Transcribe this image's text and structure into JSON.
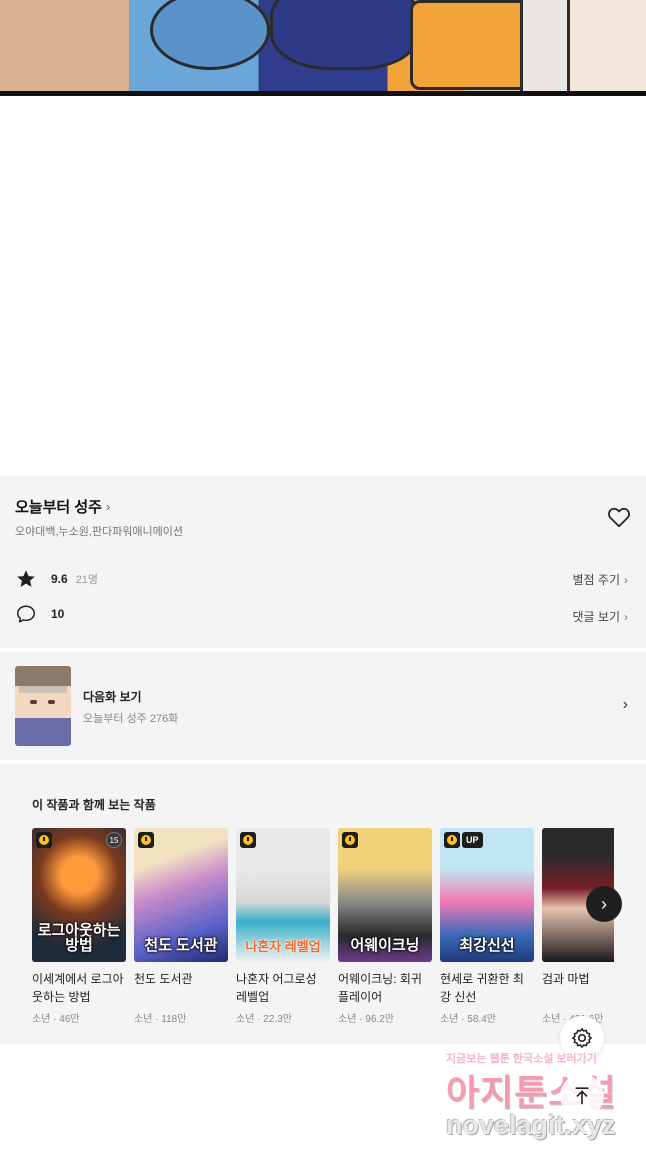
{
  "series": {
    "title": "오늘부터 성주",
    "authors": "오야대백,누소원,판다파워애니메이션",
    "rating": "9.6",
    "rating_count": "21명",
    "rate_label": "별점 주기",
    "comments": "10",
    "comments_label": "댓글 보기"
  },
  "next_episode": {
    "label": "다음화 보기",
    "subtitle": "오늘부터 성주 276화"
  },
  "recommendations": {
    "heading": "이 작품과 함께 보는 작품",
    "items": [
      {
        "title": "이세계에서 로그아웃하는 방법",
        "meta": "소년 · 46만",
        "cover_text": "로그아웃하는 방법",
        "age_badge": "15",
        "up_badge": ""
      },
      {
        "title": "천도 도서관",
        "meta": "소년 · 118만",
        "cover_text": "천도 도서관",
        "age_badge": "",
        "up_badge": ""
      },
      {
        "title": "나혼자 어그로성 레벨업",
        "meta": "소년 · 22.3만",
        "cover_text": "나혼자 레벨업",
        "age_badge": "",
        "up_badge": ""
      },
      {
        "title": "어웨이크닝: 회귀 플레이어",
        "meta": "소년 · 96.2만",
        "cover_text": "어웨이크닝",
        "age_badge": "",
        "up_badge": ""
      },
      {
        "title": "현세로 귀환한 최강 신선",
        "meta": "소년 · 58.4만",
        "cover_text": "최강신선",
        "age_badge": "",
        "up_badge": "UP"
      },
      {
        "title": "검과 마법",
        "meta": "소년 · 431.6만",
        "cover_text": "",
        "age_badge": "",
        "up_badge": ""
      }
    ]
  },
  "watermark": {
    "line1": "지금보는 웹툰 한국소설 보러가기",
    "line2": "아지툰소설",
    "line3": "novelagit.xyz"
  },
  "icons": {
    "heart": "heart-outline-icon",
    "star": "star-icon",
    "comment": "comment-bubble-icon",
    "settings": "gear-icon",
    "scroll_top": "arrow-up-icon",
    "carousel_next": "chevron-right-icon"
  }
}
